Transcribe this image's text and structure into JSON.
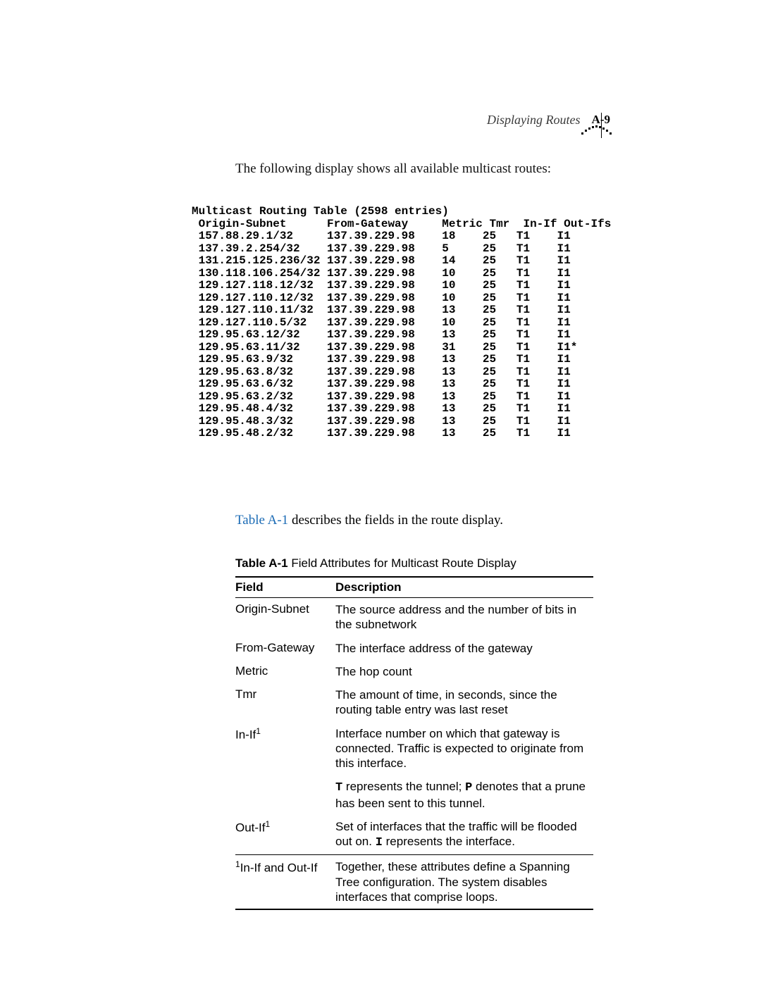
{
  "header": {
    "section_title": "Displaying Routes",
    "page_number": "A-9"
  },
  "intro_text": "The following display shows all available multicast routes:",
  "routing_table": {
    "title": "Multicast Routing Table (2598 entries)",
    "columns": [
      "Origin-Subnet",
      "From-Gateway",
      "Metric",
      "Tmr",
      "In-If",
      "Out-Ifs"
    ],
    "rows": [
      [
        "157.88.29.1/32",
        "137.39.229.98",
        "18",
        "25",
        "T1",
        "I1"
      ],
      [
        "137.39.2.254/32",
        "137.39.229.98",
        "5",
        "25",
        "T1",
        "I1"
      ],
      [
        "131.215.125.236/32",
        "137.39.229.98",
        "14",
        "25",
        "T1",
        "I1"
      ],
      [
        "130.118.106.254/32",
        "137.39.229.98",
        "10",
        "25",
        "T1",
        "I1"
      ],
      [
        "129.127.118.12/32",
        "137.39.229.98",
        "10",
        "25",
        "T1",
        "I1"
      ],
      [
        "129.127.110.12/32",
        "137.39.229.98",
        "10",
        "25",
        "T1",
        "I1"
      ],
      [
        "129.127.110.11/32",
        "137.39.229.98",
        "13",
        "25",
        "T1",
        "I1"
      ],
      [
        "129.127.110.5/32",
        "137.39.229.98",
        "10",
        "25",
        "T1",
        "I1"
      ],
      [
        "129.95.63.12/32",
        "137.39.229.98",
        "13",
        "25",
        "T1",
        "I1"
      ],
      [
        "129.95.63.11/32",
        "137.39.229.98",
        "31",
        "25",
        "T1",
        "I1*"
      ],
      [
        "129.95.63.9/32",
        "137.39.229.98",
        "13",
        "25",
        "T1",
        "I1"
      ],
      [
        "129.95.63.8/32",
        "137.39.229.98",
        "13",
        "25",
        "T1",
        "I1"
      ],
      [
        "129.95.63.6/32",
        "137.39.229.98",
        "13",
        "25",
        "T1",
        "I1"
      ],
      [
        "129.95.63.2/32",
        "137.39.229.98",
        "13",
        "25",
        "T1",
        "I1"
      ],
      [
        "129.95.48.4/32",
        "137.39.229.98",
        "13",
        "25",
        "T1",
        "I1"
      ],
      [
        "129.95.48.3/32",
        "137.39.229.98",
        "13",
        "25",
        "T1",
        "I1"
      ],
      [
        "129.95.48.2/32",
        "137.39.229.98",
        "13",
        "25",
        "T1",
        "I1"
      ]
    ]
  },
  "table_reference": {
    "link_text": "Table A-1",
    "rest_text": " describes the fields in the route display."
  },
  "attr_table": {
    "caption_bold": "Table A-1",
    "caption_rest": "  Field Attributes for Multicast Route Display",
    "head_field": "Field",
    "head_desc": "Description",
    "rows": [
      {
        "field": "Origin-Subnet",
        "sup": "",
        "desc": "The source address and the number of bits in the subnetwork"
      },
      {
        "field": "From-Gateway",
        "sup": "",
        "desc": "The interface address of the gateway"
      },
      {
        "field": "Metric",
        "sup": "",
        "desc": "The hop count"
      },
      {
        "field": "Tmr",
        "sup": "",
        "desc": "The amount of time, in seconds, since the routing table entry was last reset"
      },
      {
        "field": "In-If",
        "sup": "1",
        "desc": "Interface number on which that gateway is connected. Traffic is expected to originate from this interface."
      },
      {
        "field": "",
        "sup": "",
        "desc_html": "<span class='mono-in-text'>T</span> represents the tunnel; <span class='mono-in-text'>P</span> denotes that a prune has been sent to this tunnel."
      },
      {
        "field": "Out-If",
        "sup": "1",
        "desc_html": "Set of interfaces that the traffic will be flooded out on. <span class='mono-in-text'>I</span> represents the interface."
      }
    ],
    "footnote": {
      "mark": "1",
      "field": "In-If and Out-If",
      "desc": "Together, these attributes define a Spanning Tree configuration. The system disables interfaces that comprise loops."
    }
  }
}
